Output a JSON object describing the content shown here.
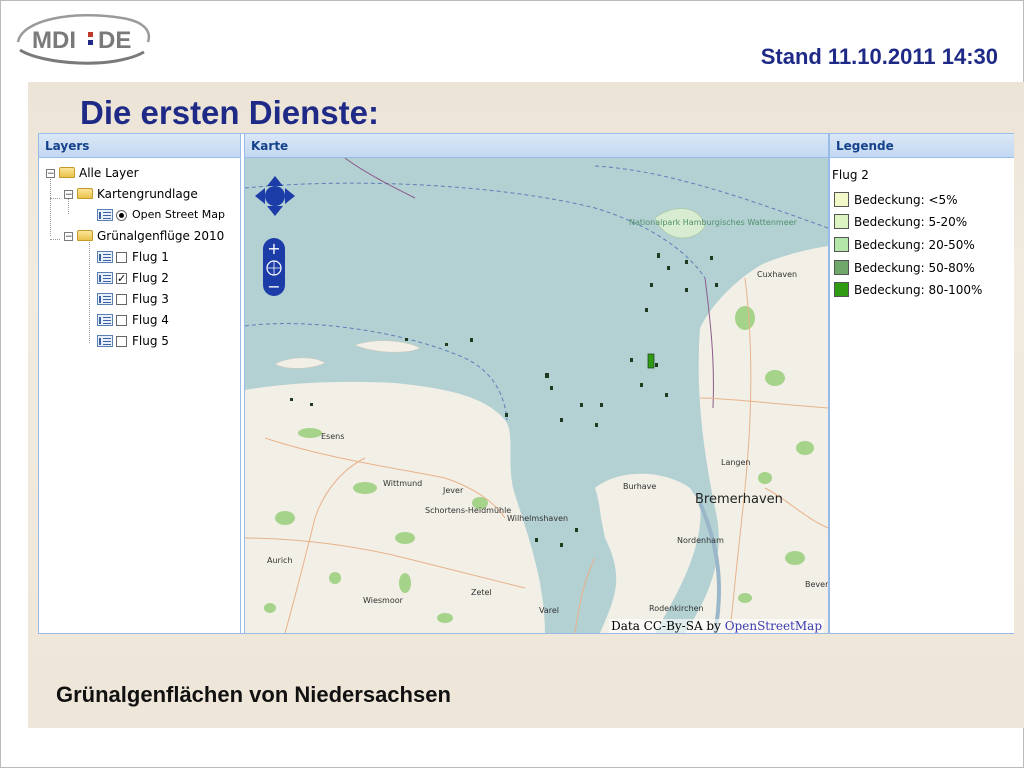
{
  "logo": {
    "text": "MDI DE"
  },
  "header": {
    "stand": "Stand 11.10.2011 14:30"
  },
  "slide": {
    "title": "Die ersten Dienste:",
    "caption": "Grünalgenflächen von Niedersachsen"
  },
  "panels": {
    "layers_title": "Layers",
    "map_title": "Karte",
    "legend_title": "Legende"
  },
  "layer_tree": {
    "root": "Alle Layer",
    "base_group": "Kartengrundlage",
    "base_layer": {
      "label": "Open Street Map",
      "selected": true
    },
    "overlay_group": "Grünalgenflüge 2010",
    "overlays": [
      {
        "label": "Flug 1",
        "checked": false
      },
      {
        "label": "Flug 2",
        "checked": true
      },
      {
        "label": "Flug 3",
        "checked": false
      },
      {
        "label": "Flug 4",
        "checked": false
      },
      {
        "label": "Flug 5",
        "checked": false
      }
    ]
  },
  "legend": {
    "layer": "Flug 2",
    "items": [
      {
        "label": "Bedeckung: <5%",
        "color": "#f2f8c8"
      },
      {
        "label": "Bedeckung: 5-20%",
        "color": "#dcf3c2"
      },
      {
        "label": "Bedeckung: 20-50%",
        "color": "#b3e6a8"
      },
      {
        "label": "Bedeckung: 50-80%",
        "color": "#6fa86a"
      },
      {
        "label": "Bedeckung: 80-100%",
        "color": "#2e9b12"
      }
    ]
  },
  "map": {
    "attribution_prefix": "Data CC-By-SA by ",
    "attribution_link": "OpenStreetMap",
    "park_label": "Nationalpark Hamburgisches Wattenmeer",
    "places": {
      "cuxhaven": "Cuxhaven",
      "esens": "Esens",
      "wittmund": "Wittmund",
      "jever": "Jever",
      "schortens": "Schortens-Heidmühle",
      "wilhelmshaven": "Wilhelmshaven",
      "burhave": "Burhave",
      "bremerhaven": "Bremerhaven",
      "langen": "Langen",
      "nordenham": "Nordenham",
      "aurich": "Aurich",
      "zetel": "Zetel",
      "wiesmoor": "Wiesmoor",
      "varel": "Varel",
      "rodenkirchen": "Rodenkirchen",
      "bever": "Bever"
    },
    "colors": {
      "water": "#b3d0d3",
      "land": "#f2efe6",
      "forest": "#a5d38a"
    }
  }
}
